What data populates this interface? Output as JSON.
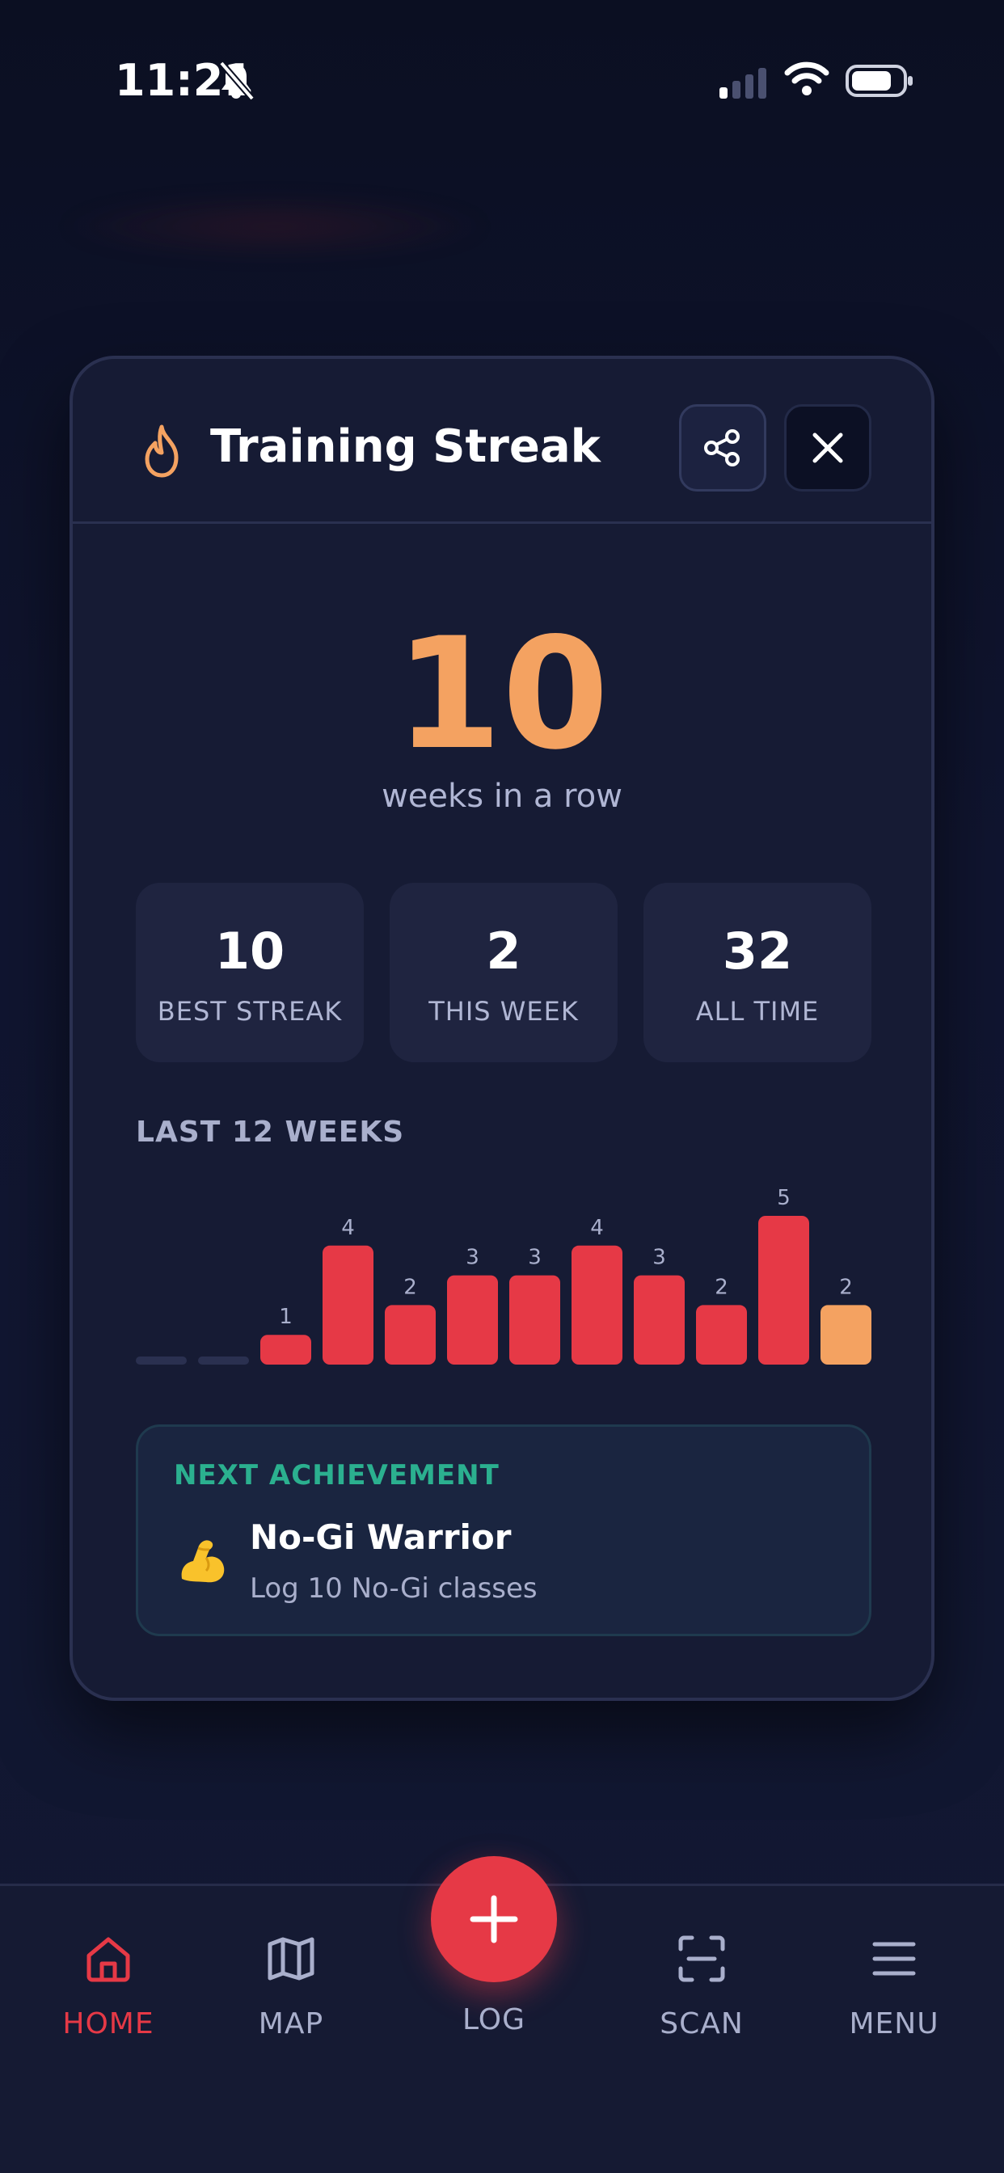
{
  "status_bar": {
    "time": "11:21"
  },
  "card": {
    "title": "Training Streak",
    "streak_value": "10",
    "streak_label": "weeks in a row",
    "stats": [
      {
        "value": "10",
        "label": "BEST STREAK"
      },
      {
        "value": "2",
        "label": "THIS WEEK"
      },
      {
        "value": "32",
        "label": "ALL TIME"
      }
    ],
    "weeks_title": "LAST 12 WEEKS",
    "achievement": {
      "label": "NEXT ACHIEVEMENT",
      "title": "No-Gi Warrior",
      "description": "Log 10 No-Gi classes"
    }
  },
  "chart_data": {
    "type": "bar",
    "values": [
      0,
      0,
      1,
      4,
      2,
      3,
      3,
      4,
      3,
      2,
      5,
      2
    ],
    "ylim": [
      0,
      5
    ],
    "colors": {
      "past": "#e63946",
      "current": "#f4a261",
      "empty": "#2a3050"
    }
  },
  "bottom_nav": {
    "items": [
      {
        "label": "HOME",
        "icon": "home-icon",
        "active": true
      },
      {
        "label": "MAP",
        "icon": "map-icon",
        "active": false
      },
      {
        "label": "LOG",
        "icon": "plus-icon",
        "active": false
      },
      {
        "label": "SCAN",
        "icon": "scan-icon",
        "active": false
      },
      {
        "label": "MENU",
        "icon": "menu-icon",
        "active": false
      }
    ]
  },
  "colors": {
    "accent_red": "#e63946",
    "accent_orange": "#f4a261",
    "accent_green": "#2bb08f",
    "card_bg": "#161b34"
  }
}
